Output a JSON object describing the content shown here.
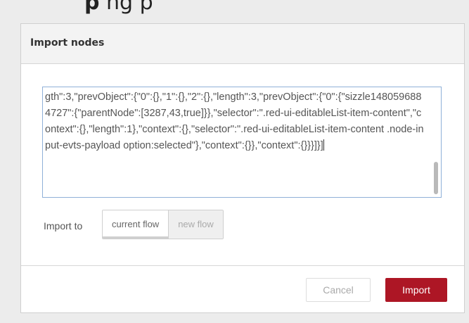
{
  "background": {
    "partial_text_before": "",
    "partial_text_bold": "p",
    "partial_text_after": "  ng p"
  },
  "dialog": {
    "title": "Import nodes",
    "textarea_content": "gth\":3,\"prevObject\":{\"0\":{},\"1\":{},\"2\":{},\"length\":3,\"prevObject\":{\"0\":{\"sizzle1480596884727\":{\"parentNode\":[3287,43,true]}},\"selector\":\".red-ui-editableList-item-content\",\"context\":{},\"length\":1},\"context\":{},\"selector\":\".red-ui-editableList-item-content .node-input-evts-payload option:selected\"},\"context\":{}},\"context\":{}}}]}]",
    "import_to_label": "Import to",
    "import_options": [
      "current flow",
      "new flow"
    ],
    "selected_option": "current flow",
    "cancel_label": "Cancel",
    "import_label": "Import"
  },
  "colors": {
    "primary_button": "#ad1625",
    "textarea_focus_border": "#8fb0d8"
  }
}
